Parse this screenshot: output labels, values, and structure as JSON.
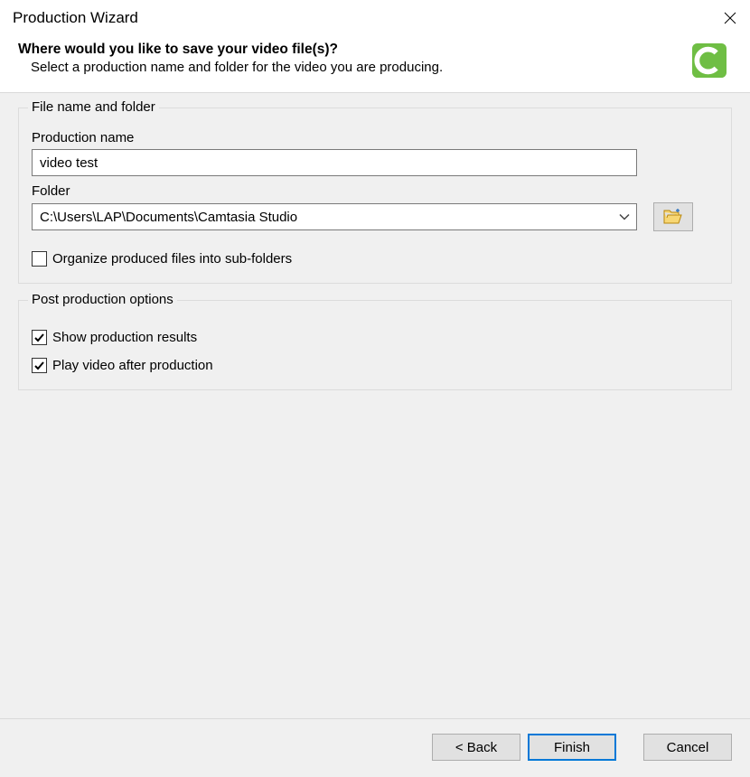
{
  "window": {
    "title": "Production Wizard"
  },
  "header": {
    "heading": "Where would you like to save your video file(s)?",
    "sub": "Select a production name and folder for the video you are producing."
  },
  "file_group": {
    "legend": "File name and folder",
    "production_name_label": "Production name",
    "production_name_value": "video test",
    "folder_label": "Folder",
    "folder_value": "C:\\Users\\LAP\\Documents\\Camtasia Studio",
    "organize_label": "Organize produced files into sub-folders",
    "organize_checked": false
  },
  "post_group": {
    "legend": "Post production options",
    "show_results_label": "Show production results",
    "show_results_checked": true,
    "play_after_label": "Play video after production",
    "play_after_checked": true
  },
  "buttons": {
    "back": "< Back",
    "finish": "Finish",
    "cancel": "Cancel"
  },
  "icons": {
    "close": "close-icon",
    "browse": "folder-open-icon",
    "logo": "camtasia-logo"
  },
  "colors": {
    "logo_green": "#6FBE44",
    "accent_blue": "#0078d7",
    "content_bg": "#f0f0f0"
  }
}
